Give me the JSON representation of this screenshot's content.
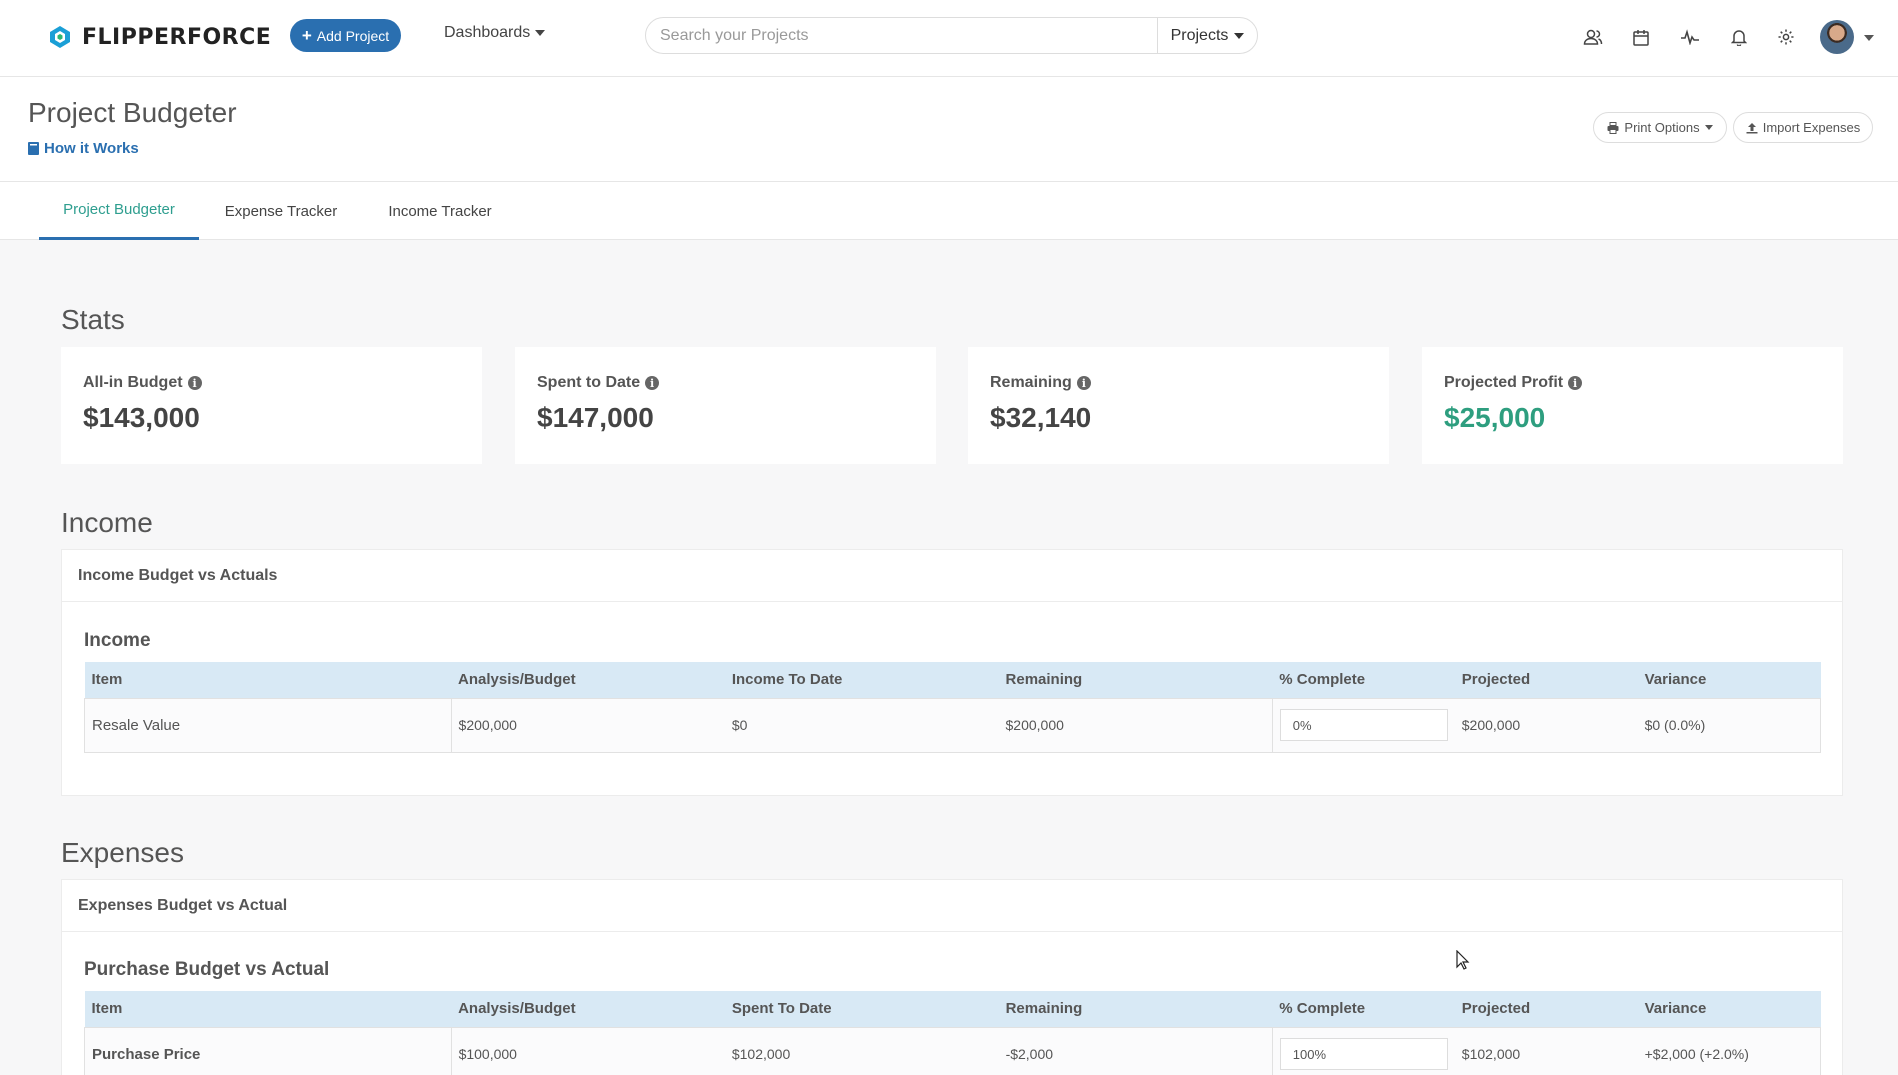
{
  "header": {
    "brand": "FLIPPERFORCE",
    "add_project": "Add Project",
    "dashboards": "Dashboards",
    "search_placeholder": "Search your Projects",
    "search_scope": "Projects"
  },
  "page": {
    "title": "Project Budgeter",
    "how_it_works": "How it Works",
    "print_options": "Print Options",
    "import_expenses": "Import Expenses"
  },
  "tabs": [
    "Project Budgeter",
    "Expense Tracker",
    "Income Tracker"
  ],
  "stats": {
    "title": "Stats",
    "cards": [
      {
        "label": "All-in Budget",
        "value": "$143,000"
      },
      {
        "label": "Spent to Date",
        "value": "$147,000"
      },
      {
        "label": "Remaining",
        "value": "$32,140"
      },
      {
        "label": "Projected Profit",
        "value": "$25,000"
      }
    ]
  },
  "income": {
    "title": "Income",
    "panel_title": "Income Budget vs Actuals",
    "subtitle": "Income",
    "columns": [
      "Item",
      "Analysis/Budget",
      "Income To Date",
      "Remaining",
      "% Complete",
      "Projected",
      "Variance"
    ],
    "rows": [
      {
        "item": "Resale Value",
        "budget": "$200,000",
        "to_date": "$0",
        "remaining": "$200,000",
        "pct": "0%",
        "projected": "$200,000",
        "variance": "$0 (0.0%)"
      }
    ]
  },
  "expenses": {
    "title": "Expenses",
    "panel_title": "Expenses Budget vs Actual",
    "subtitle": "Purchase Budget vs Actual",
    "columns": [
      "Item",
      "Analysis/Budget",
      "Spent To Date",
      "Remaining",
      "% Complete",
      "Projected",
      "Variance"
    ],
    "rows": [
      {
        "item": "Purchase Price",
        "budget": "$100,000",
        "to_date": "$102,000",
        "remaining": "-$2,000",
        "pct": "100%",
        "projected": "$102,000",
        "variance": "+$2,000 (+2.0%)"
      }
    ]
  },
  "colors": {
    "accent_blue": "#2a6fb0",
    "accent_green": "#2e9e7f",
    "table_header": "#d8e9f5",
    "negative": "#d9534f"
  },
  "icons": [
    "users-icon",
    "calendar-icon",
    "activity-icon",
    "bell-icon",
    "gear-icon",
    "book-icon",
    "print-icon",
    "upload-icon",
    "info-icon"
  ]
}
